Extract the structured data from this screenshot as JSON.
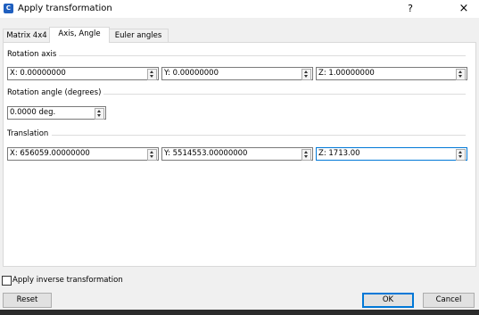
{
  "window": {
    "title": "Apply transformation",
    "help": "?",
    "close": "×",
    "app_icon": "C"
  },
  "tabs": [
    {
      "label": "Matrix 4x4"
    },
    {
      "label": "Axis, Angle"
    },
    {
      "label": "Euler angles"
    }
  ],
  "rotation_axis": {
    "label": "Rotation axis",
    "x": "X: 0.00000000",
    "y": "Y: 0.00000000",
    "z": "Z: 1.00000000"
  },
  "rotation_angle": {
    "label": "Rotation angle (degrees)",
    "value": "0.0000 deg."
  },
  "translation": {
    "label": "Translation",
    "x": "X: 656059.00000000",
    "y": "Y: 5514553.00000000",
    "z": "Z: 1713.00"
  },
  "inverse": {
    "label": "Apply inverse transformation",
    "checked": false
  },
  "buttons": {
    "reset": "Reset",
    "ok": "OK",
    "cancel": "Cancel"
  },
  "colors": {
    "focus": "#0078d7",
    "app_icon": "#1f5fbf"
  }
}
